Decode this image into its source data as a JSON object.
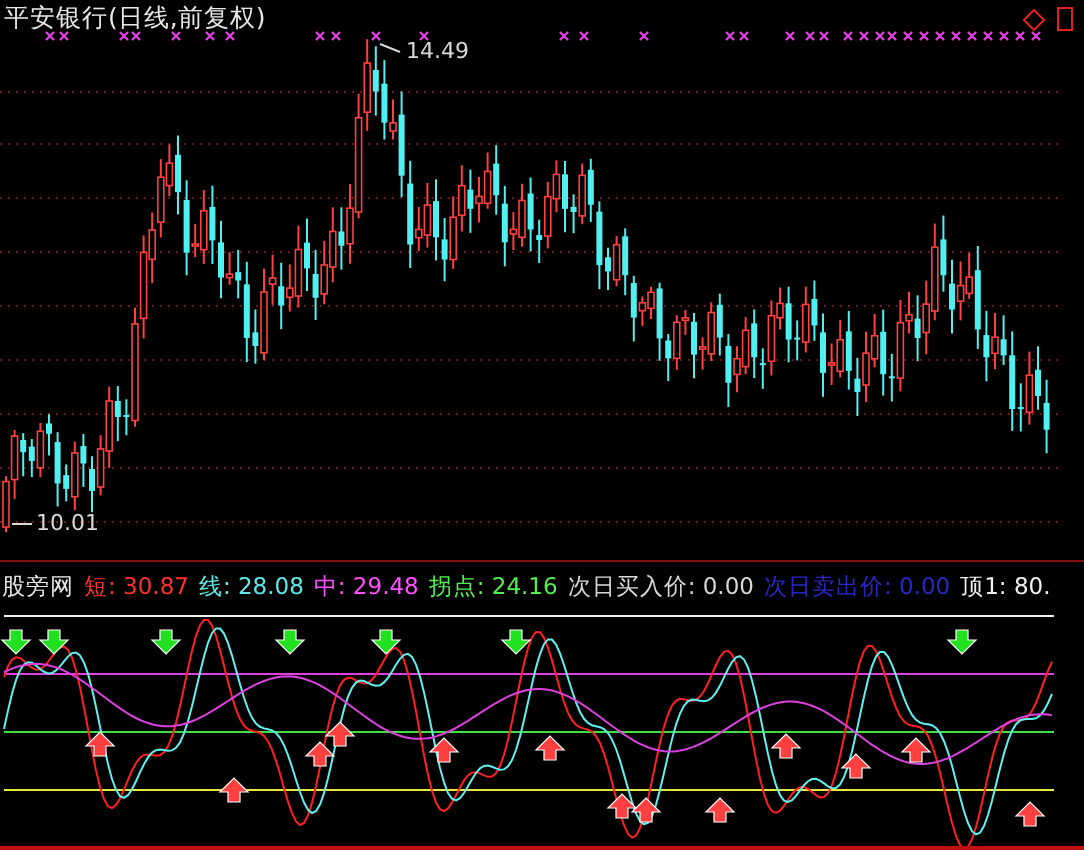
{
  "title": "平安银行(日线,前复权)",
  "price_chart": {
    "high_label": "14.49",
    "low_label": "10.01"
  },
  "indicator": {
    "name": "股旁网",
    "legend": [
      {
        "text": "短: 30.87",
        "color": "#ff3030"
      },
      {
        "text": "线: 28.08",
        "color": "#60e8e8"
      },
      {
        "text": "中: 29.48",
        "color": "#ff50ff"
      },
      {
        "text": "拐点: 24.16",
        "color": "#50f050"
      },
      {
        "text": "次日买入价: 0.00",
        "color": "#d8d8d8"
      },
      {
        "text": "次日卖出价: 0.00",
        "color": "#2828c8"
      },
      {
        "text": "顶1: 80.",
        "color": "#f0f0f0"
      }
    ]
  }
}
